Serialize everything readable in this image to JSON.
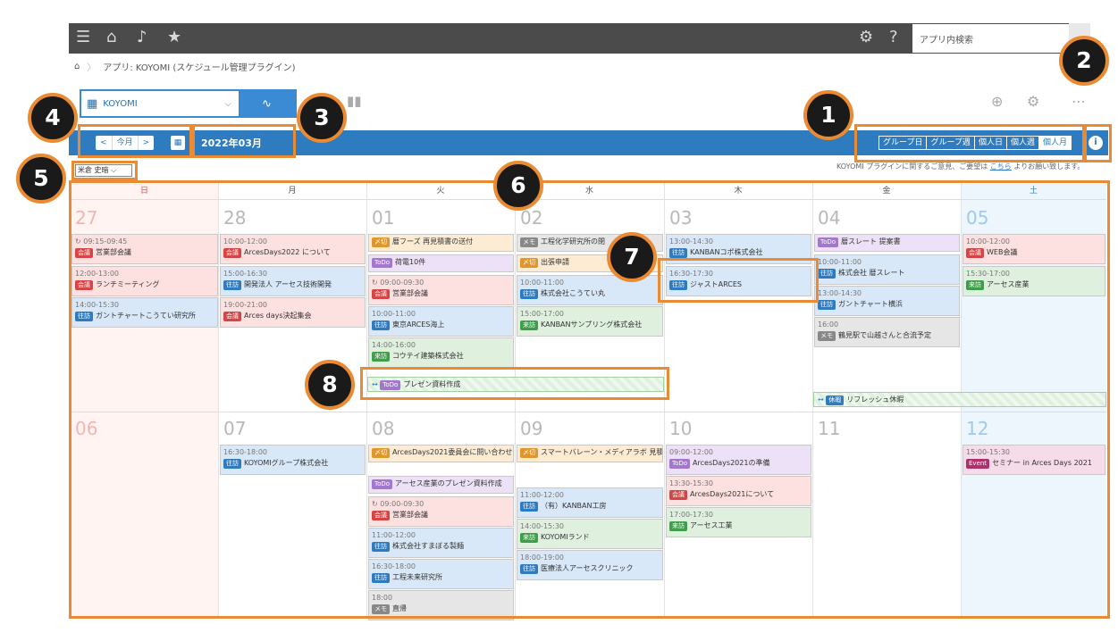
{
  "app": {
    "breadcrumb": "アプリ: KOYOMI (スケジュール管理プラグイン)",
    "search_placeholder": "アプリ内検索"
  },
  "toolbar": {
    "view_name": "KOYOMI",
    "nav_prev": "<",
    "nav_today": "今月",
    "nav_next": ">",
    "month": "2022年03月",
    "modes": [
      "グループ日",
      "グループ週",
      "個人日",
      "個人週",
      "個人月"
    ],
    "active_mode": "個人月",
    "user": "米倉 史暗",
    "feedback_pre": "KOYOMI プラグインに関するご意見、ご要望は",
    "feedback_link": "こちら",
    "feedback_post": "よりお願い致します。"
  },
  "weekdays": [
    "日",
    "月",
    "火",
    "水",
    "木",
    "金",
    "土"
  ],
  "dates": [
    "27",
    "28",
    "01",
    "02",
    "03",
    "04",
    "05",
    "06",
    "07",
    "08",
    "09",
    "10",
    "11",
    "12"
  ],
  "colors": {
    "kaigi": "#d64545",
    "ohou": "#2f7bbf",
    "raihou": "#3e9e4a",
    "todo": "#a377cf",
    "memo": "#888888",
    "shime": "#e0962a",
    "event": "#b0306b",
    "kyuka": "#2f7bbf"
  },
  "events": [
    {
      "time": "09:15-09:45",
      "tag": "会議",
      "title": "営業部会議",
      "cls": "kaigi",
      "repeat": true
    },
    {
      "time": "12:00-13:00",
      "tag": "会議",
      "title": "ランチミーティング",
      "cls": "kaigi"
    },
    {
      "time": "14:00-15:30",
      "tag": "往訪",
      "title": "ガントチャートこうてい研究所",
      "cls": "ohou"
    },
    {
      "time": "10:00-12:00",
      "tag": "会議",
      "title": "ArcesDays2022 について",
      "cls": "kaigi"
    },
    {
      "time": "15:00-16:30",
      "tag": "往訪",
      "title": "開発法人 アーセス技術開発",
      "cls": "ohou"
    },
    {
      "time": "19:00-21:00",
      "tag": "会議",
      "title": "Arces days決起集会",
      "cls": "kaigi"
    },
    {
      "time": "",
      "tag": "〆切",
      "title": "暦フーズ 再見積書の送付",
      "cls": "shime"
    },
    {
      "time": "",
      "tag": "ToDo",
      "title": "荷電10件",
      "cls": "todo"
    },
    {
      "time": "09:00-09:30",
      "tag": "会議",
      "title": "営業部会議",
      "cls": "kaigi",
      "repeat": true
    },
    {
      "time": "10:00-11:00",
      "tag": "往訪",
      "title": "東京ARCES海上",
      "cls": "ohou"
    },
    {
      "time": "14:00-16:00",
      "tag": "来訪",
      "title": "コウテイ建築株式会社",
      "cls": "raihou"
    },
    {
      "time": "",
      "tag": "メモ",
      "title": "工程化学研究所の閉",
      "cls": "memo"
    },
    {
      "time": "",
      "tag": "〆切",
      "title": "出張申請",
      "cls": "shime"
    },
    {
      "time": "10:00-11:00",
      "tag": "往訪",
      "title": "株式会社こうてい丸",
      "cls": "ohou"
    },
    {
      "time": "15:00-17:00",
      "tag": "来訪",
      "title": "KANBANサンプリング株式会社",
      "cls": "raihou"
    },
    {
      "time": "13:00-14:30",
      "tag": "往訪",
      "title": "KANBANコポ株式会社",
      "cls": "ohou"
    },
    {
      "time": "16:30-17:30",
      "tag": "往訪",
      "title": "ジャストARCES",
      "cls": "ohou"
    },
    {
      "time": "",
      "tag": "ToDo",
      "title": "暦スレート 提案書",
      "cls": "todo"
    },
    {
      "time": "10:00-11:00",
      "tag": "往訪",
      "title": "株式会社 暦スレート",
      "cls": "ohou"
    },
    {
      "time": "13:00-14:30",
      "tag": "往訪",
      "title": "ガントチャート横浜",
      "cls": "ohou"
    },
    {
      "time": "16:00",
      "tag": "メモ",
      "title": "鶴見駅で山越さんと合流予定",
      "cls": "memo"
    },
    {
      "time": "10:00-12:00",
      "tag": "会議",
      "title": "WEB会議",
      "cls": "kaigi"
    },
    {
      "time": "15:30-17:00",
      "tag": "来訪",
      "title": "アーセス産業",
      "cls": "raihou"
    },
    {
      "time": "16:30-18:00",
      "tag": "往訪",
      "title": "KOYOMIグループ株式会社",
      "cls": "ohou"
    },
    {
      "time": "",
      "tag": "〆切",
      "title": "ArcesDays2021委員会に問い合わせ",
      "cls": "shime"
    },
    {
      "time": "",
      "tag": "ToDo",
      "title": "アーセス産業のプレゼン資料作成",
      "cls": "todo"
    },
    {
      "time": "09:00-09:30",
      "tag": "会議",
      "title": "営業部会議",
      "cls": "kaigi",
      "repeat": true
    },
    {
      "time": "11:00-12:00",
      "tag": "往訪",
      "title": "株式会社すまぼる製麺",
      "cls": "ohou"
    },
    {
      "time": "16:30-18:00",
      "tag": "往訪",
      "title": "工程未来研究所",
      "cls": "ohou"
    },
    {
      "time": "18:00",
      "tag": "メモ",
      "title": "直帰",
      "cls": "memo"
    },
    {
      "time": "",
      "tag": "〆切",
      "title": "スマートバレーン・メディアラボ 見積書の送付",
      "cls": "shime"
    },
    {
      "time": "11:00-12:00",
      "tag": "往訪",
      "title": "（有）KANBAN工房",
      "cls": "ohou"
    },
    {
      "time": "14:00-15:30",
      "tag": "来訪",
      "title": "KOYOMIランド",
      "cls": "raihou"
    },
    {
      "time": "18:00-19:00",
      "tag": "往訪",
      "title": "医療法人アーセスクリニック",
      "cls": "ohou"
    },
    {
      "time": "09:00-12:00",
      "tag": "ToDo",
      "title": "ArcesDays2021の準備",
      "cls": "todo"
    },
    {
      "time": "13:30-15:30",
      "tag": "会議",
      "title": "ArcesDays2021について",
      "cls": "kaigi"
    },
    {
      "time": "17:00-17:30",
      "tag": "来訪",
      "title": "アーセス工業",
      "cls": "raihou"
    },
    {
      "time": "15:00-15:30",
      "tag": "Event",
      "title": "セミナー in Arces Days 2021",
      "cls": "event"
    }
  ],
  "span_events": [
    {
      "tag": "ToDo",
      "title": "プレゼン資料作成",
      "cls": "todo"
    },
    {
      "tag": "休暇",
      "title": "リフレッシュ休暇",
      "cls": "kyuka"
    }
  ],
  "badges": [
    "1",
    "2",
    "3",
    "4",
    "5",
    "6",
    "7",
    "8"
  ]
}
